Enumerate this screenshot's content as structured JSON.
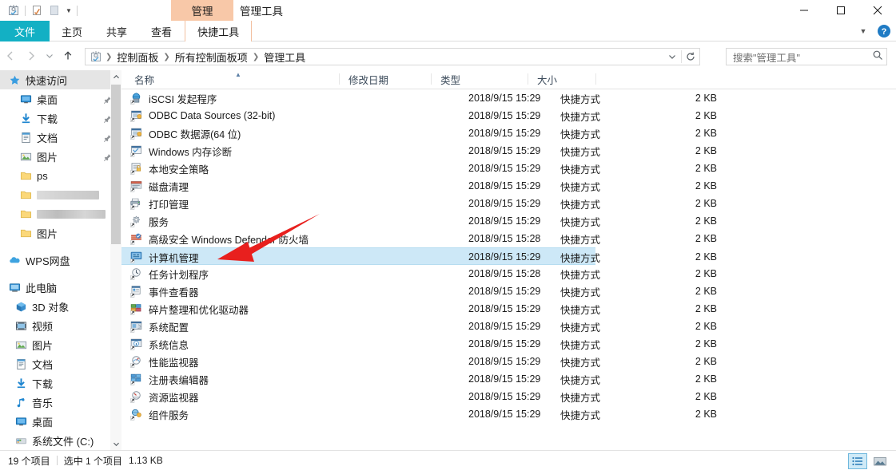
{
  "window": {
    "title": "管理工具",
    "contextual_tab_group": "管理",
    "controls": {
      "minimize": "最小化",
      "maximize": "最大化",
      "close": "关闭"
    }
  },
  "quick_access_toolbar": {
    "items": [
      {
        "name": "admin-tools-icon",
        "label": "管理工具"
      },
      {
        "name": "properties-icon",
        "label": "属性"
      },
      {
        "name": "new-folder-icon",
        "label": "新建文件夹"
      },
      {
        "name": "customize-caret",
        "label": "自定义快速访问工具栏"
      }
    ]
  },
  "ribbon": {
    "tabs": [
      {
        "label": "文件",
        "active": false,
        "style": "file"
      },
      {
        "label": "主页",
        "active": false,
        "style": "normal"
      },
      {
        "label": "共享",
        "active": false,
        "style": "normal"
      },
      {
        "label": "查看",
        "active": false,
        "style": "normal"
      },
      {
        "label": "快捷工具",
        "active": true,
        "style": "contextual"
      }
    ],
    "expand_label": "展开功能区",
    "help_label": "帮助"
  },
  "address_bar": {
    "back_label": "后退",
    "forward_label": "前进",
    "recent_label": "最近浏览的位置",
    "up_label": "上移到 所有控制面板项",
    "breadcrumbs": [
      "控制面板",
      "所有控制面板项",
      "管理工具"
    ],
    "dropdown_label": "以前的位置",
    "refresh_label": "刷新"
  },
  "search": {
    "placeholder": "搜索\"管理工具\"",
    "icon": "search-icon"
  },
  "sidebar": {
    "groups": [
      {
        "header": {
          "label": "快速访问",
          "icon": "star-icon",
          "selected": true
        },
        "items": [
          {
            "label": "桌面",
            "icon": "desktop-icon",
            "pinned": true
          },
          {
            "label": "下载",
            "icon": "download-icon",
            "pinned": true
          },
          {
            "label": "文档",
            "icon": "documents-icon",
            "pinned": true
          },
          {
            "label": "图片",
            "icon": "pictures-icon",
            "pinned": true
          },
          {
            "label": "ps",
            "icon": "folder-icon",
            "pinned": false
          },
          {
            "label": "",
            "icon": "folder-icon",
            "pinned": false,
            "redacted": true
          },
          {
            "label": "",
            "icon": "folder-icon",
            "pinned": false,
            "redacted": true
          },
          {
            "label": "图片",
            "icon": "folder-icon",
            "pinned": false
          }
        ]
      },
      {
        "header": {
          "label": "WPS网盘",
          "icon": "cloud-icon",
          "selected": false
        },
        "items": []
      },
      {
        "header": {
          "label": "此电脑",
          "icon": "this-pc-icon",
          "selected": false
        },
        "items": [
          {
            "label": "3D 对象",
            "icon": "3d-objects-icon",
            "pinned": false
          },
          {
            "label": "视频",
            "icon": "videos-icon",
            "pinned": false
          },
          {
            "label": "图片",
            "icon": "pictures-icon",
            "pinned": false
          },
          {
            "label": "文档",
            "icon": "documents-icon",
            "pinned": false
          },
          {
            "label": "下载",
            "icon": "download-icon",
            "pinned": false
          },
          {
            "label": "音乐",
            "icon": "music-icon",
            "pinned": false
          },
          {
            "label": "桌面",
            "icon": "desktop-icon",
            "pinned": false
          },
          {
            "label": "系统文件 (C:)",
            "icon": "drive-icon",
            "pinned": false
          }
        ]
      }
    ]
  },
  "file_list": {
    "columns": [
      {
        "label": "名称",
        "sorted": "asc"
      },
      {
        "label": "修改日期",
        "sorted": ""
      },
      {
        "label": "类型",
        "sorted": ""
      },
      {
        "label": "大小",
        "sorted": ""
      }
    ],
    "rows": [
      {
        "name": "iSCSI 发起程序",
        "date": "2018/9/15 15:29",
        "type": "快捷方式",
        "size": "2 KB",
        "selected": false,
        "icon": "iscsi-shortcut-icon"
      },
      {
        "name": "ODBC Data Sources (32-bit)",
        "date": "2018/9/15 15:29",
        "type": "快捷方式",
        "size": "2 KB",
        "selected": false,
        "icon": "odbc-shortcut-icon"
      },
      {
        "name": "ODBC 数据源(64 位)",
        "date": "2018/9/15 15:29",
        "type": "快捷方式",
        "size": "2 KB",
        "selected": false,
        "icon": "odbc-shortcut-icon"
      },
      {
        "name": "Windows 内存诊断",
        "date": "2018/9/15 15:29",
        "type": "快捷方式",
        "size": "2 KB",
        "selected": false,
        "icon": "memory-diagnostic-shortcut-icon"
      },
      {
        "name": "本地安全策略",
        "date": "2018/9/15 15:29",
        "type": "快捷方式",
        "size": "2 KB",
        "selected": false,
        "icon": "local-security-policy-shortcut-icon"
      },
      {
        "name": "磁盘清理",
        "date": "2018/9/15 15:29",
        "type": "快捷方式",
        "size": "2 KB",
        "selected": false,
        "icon": "disk-cleanup-shortcut-icon"
      },
      {
        "name": "打印管理",
        "date": "2018/9/15 15:29",
        "type": "快捷方式",
        "size": "2 KB",
        "selected": false,
        "icon": "print-management-shortcut-icon"
      },
      {
        "name": "服务",
        "date": "2018/9/15 15:29",
        "type": "快捷方式",
        "size": "2 KB",
        "selected": false,
        "icon": "services-shortcut-icon"
      },
      {
        "name": "高级安全 Windows Defender 防火墙",
        "date": "2018/9/15 15:28",
        "type": "快捷方式",
        "size": "2 KB",
        "selected": false,
        "icon": "firewall-shortcut-icon"
      },
      {
        "name": "计算机管理",
        "date": "2018/9/15 15:29",
        "type": "快捷方式",
        "size": "2 KB",
        "selected": true,
        "icon": "computer-management-shortcut-icon"
      },
      {
        "name": "任务计划程序",
        "date": "2018/9/15 15:28",
        "type": "快捷方式",
        "size": "2 KB",
        "selected": false,
        "icon": "task-scheduler-shortcut-icon"
      },
      {
        "name": "事件查看器",
        "date": "2018/9/15 15:29",
        "type": "快捷方式",
        "size": "2 KB",
        "selected": false,
        "icon": "event-viewer-shortcut-icon"
      },
      {
        "name": "碎片整理和优化驱动器",
        "date": "2018/9/15 15:29",
        "type": "快捷方式",
        "size": "2 KB",
        "selected": false,
        "icon": "defragment-shortcut-icon"
      },
      {
        "name": "系统配置",
        "date": "2018/9/15 15:29",
        "type": "快捷方式",
        "size": "2 KB",
        "selected": false,
        "icon": "system-config-shortcut-icon"
      },
      {
        "name": "系统信息",
        "date": "2018/9/15 15:29",
        "type": "快捷方式",
        "size": "2 KB",
        "selected": false,
        "icon": "system-info-shortcut-icon"
      },
      {
        "name": "性能监视器",
        "date": "2018/9/15 15:29",
        "type": "快捷方式",
        "size": "2 KB",
        "selected": false,
        "icon": "performance-monitor-shortcut-icon"
      },
      {
        "name": "注册表编辑器",
        "date": "2018/9/15 15:29",
        "type": "快捷方式",
        "size": "2 KB",
        "selected": false,
        "icon": "registry-editor-shortcut-icon"
      },
      {
        "name": "资源监视器",
        "date": "2018/9/15 15:29",
        "type": "快捷方式",
        "size": "2 KB",
        "selected": false,
        "icon": "resource-monitor-shortcut-icon"
      },
      {
        "name": "组件服务",
        "date": "2018/9/15 15:29",
        "type": "快捷方式",
        "size": "2 KB",
        "selected": false,
        "icon": "component-services-shortcut-icon"
      }
    ]
  },
  "status_bar": {
    "item_count": "19 个项目",
    "selection": "选中 1 个项目",
    "selection_size": "1.13 KB",
    "view_buttons": [
      {
        "name": "details-view-button",
        "label": "详细信息",
        "active": true
      },
      {
        "name": "large-icons-view-button",
        "label": "大图标",
        "active": false
      }
    ]
  },
  "annotation": {
    "type": "red-arrow",
    "color": "#e8201e",
    "points_to": "计算机管理"
  },
  "colors": {
    "file_tab": "#13b0c4",
    "contextual_group": "#f8c8a8",
    "selection": "#cde8f7",
    "annotation_red": "#e8201e"
  }
}
